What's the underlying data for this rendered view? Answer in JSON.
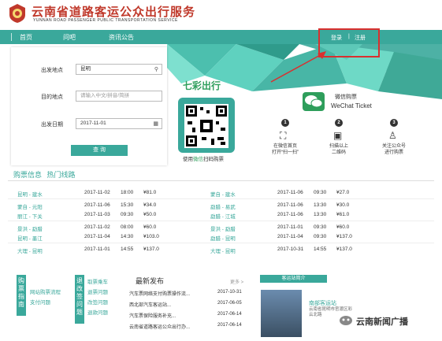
{
  "header": {
    "logo_cn": "云南省道路客运公众出行服务",
    "logo_en": "YUNNAN ROAD PASSENGER PUBLIC TRANSPORTATION SERVICE"
  },
  "nav": {
    "items": [
      "首页",
      "问吧",
      "资讯公告"
    ],
    "login": "登录",
    "sep": "|",
    "register": "注册"
  },
  "form": {
    "from_label": "出发地点",
    "from_value": "昆明",
    "to_label": "目的地点",
    "to_placeholder": "请输入中文/拼音/简拼",
    "date_label": "出发日期",
    "date_value": "2017-11-01",
    "search_button": "查 询"
  },
  "qr": {
    "title": "七彩出行",
    "caption_prefix": "使用",
    "caption_highlight": "微信",
    "caption_suffix": "扫码购票"
  },
  "wechat": {
    "title": "微信购票",
    "subtitle": "WeChat Ticket"
  },
  "steps": [
    {
      "num": "1",
      "text1": "在微信首页",
      "text2": "打开“扫一扫”"
    },
    {
      "num": "2",
      "text1": "扫描以上",
      "text2": "二维码"
    },
    {
      "num": "3",
      "text1": "关注公众号",
      "text2": "进行购票"
    }
  ],
  "info": {
    "tab1": "购票信息",
    "tab2": "热门线路"
  },
  "routes_left": [
    {
      "route": "昆明 - 建水",
      "date": "2017-11-02",
      "time": "18:00",
      "price": "¥81.0"
    },
    {
      "route": "蒙自 - 元阳",
      "date": "2017-11-06",
      "time": "15:30",
      "price": "¥34.0"
    },
    {
      "route": "丽江 - 下关",
      "date": "2017-11-03",
      "time": "09:30",
      "price": "¥50.0"
    },
    {
      "route": "景洪 - 勐腊",
      "date": "2017-11-02",
      "time": "08:00",
      "price": "¥60.0"
    },
    {
      "route": "昆明 - 墨江",
      "date": "2017-11-04",
      "time": "14:30",
      "price": "¥103.0"
    },
    {
      "route": "大理 - 昆明",
      "date": "2017-11-01",
      "time": "14:55",
      "price": "¥137.0"
    }
  ],
  "routes_right": [
    {
      "route": "蒙自 - 建水",
      "date": "2017-11-06",
      "time": "09:30",
      "price": "¥27.0"
    },
    {
      "route": "勐腊 - 易武",
      "date": "2017-11-06",
      "time": "13:30",
      "price": "¥30.0"
    },
    {
      "route": "勐腊 - 江城",
      "date": "2017-11-06",
      "time": "13:30",
      "price": "¥61.0"
    },
    {
      "route": "景洪 - 勐腊",
      "date": "2017-11-01",
      "time": "09:30",
      "price": "¥60.0"
    },
    {
      "route": "勐腊 - 昆明",
      "date": "2017-11-04",
      "time": "09:30",
      "price": "¥137.0"
    },
    {
      "route": "大理 - 昆明",
      "date": "2017-10-31",
      "time": "14:55",
      "price": "¥137.0"
    }
  ],
  "bottom": {
    "box1": "购票指南",
    "box1_links": [
      "网站购票流程",
      "支付问题"
    ],
    "box2": "退改签问题",
    "box2_links": [
      "取票乘车",
      "退票问题",
      "改签问题",
      "退款问题"
    ],
    "news_title": "最新发布",
    "more": "更多 >",
    "news": [
      {
        "title": "汽车票网络支付购票操作流...",
        "date": "2017-10-31"
      },
      {
        "title": "西北部汽车客运站...",
        "date": "2017-06-05"
      },
      {
        "title": "汽车票保险服务补充...",
        "date": "2017-06-14"
      },
      {
        "title": "云南省道路客运公众出行办...",
        "date": "2017-06-14"
      }
    ],
    "station_head": "客运站简介",
    "station_name": "南部客运站",
    "station_addr": "云南省昆明市官渡区彩云北路",
    "watermark": "云南新闻广播"
  },
  "colors": {
    "accent": "#3aa89b",
    "brand_red": "#c0392b",
    "annotation": "#d9302f"
  }
}
